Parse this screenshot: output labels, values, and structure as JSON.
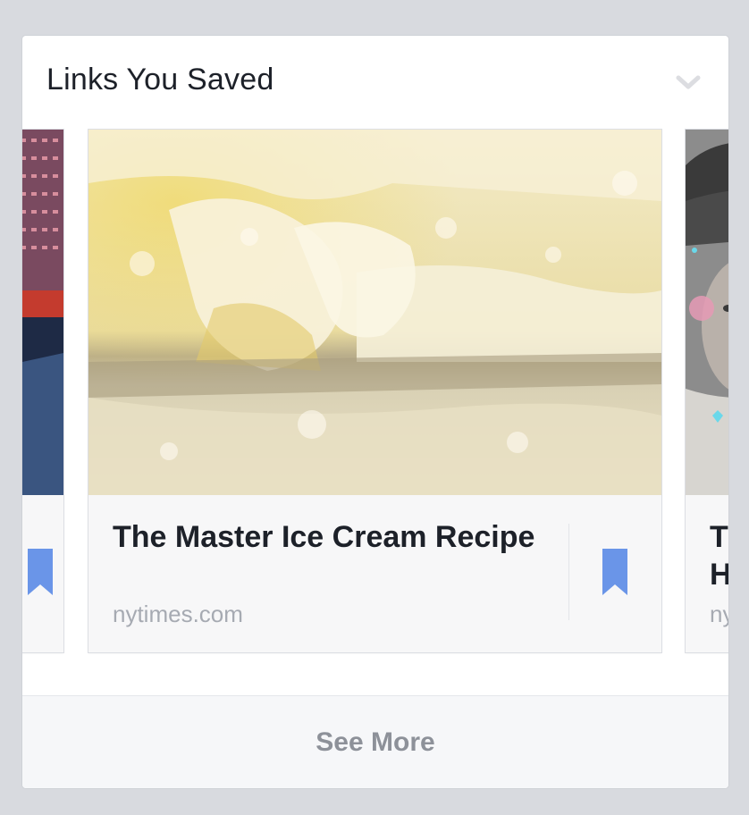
{
  "section": {
    "title": "Links You Saved",
    "chevron_icon": "chevron-down-icon"
  },
  "links": [
    {
      "title": "",
      "source": "",
      "icon": "bookmark-icon"
    },
    {
      "title": "The Master Ice Cream Recipe",
      "source": "nytimes.com",
      "icon": "bookmark-icon"
    },
    {
      "title_line1": "Th",
      "title_line2": "Ha",
      "source": "nyti",
      "icon": "bookmark-icon"
    }
  ],
  "footer": {
    "see_more_label": "See More"
  },
  "colors": {
    "bookmark": "#6a95e8",
    "title_text": "#1d2129",
    "source_text": "#a6aab2",
    "see_more_text": "#8d9199"
  }
}
